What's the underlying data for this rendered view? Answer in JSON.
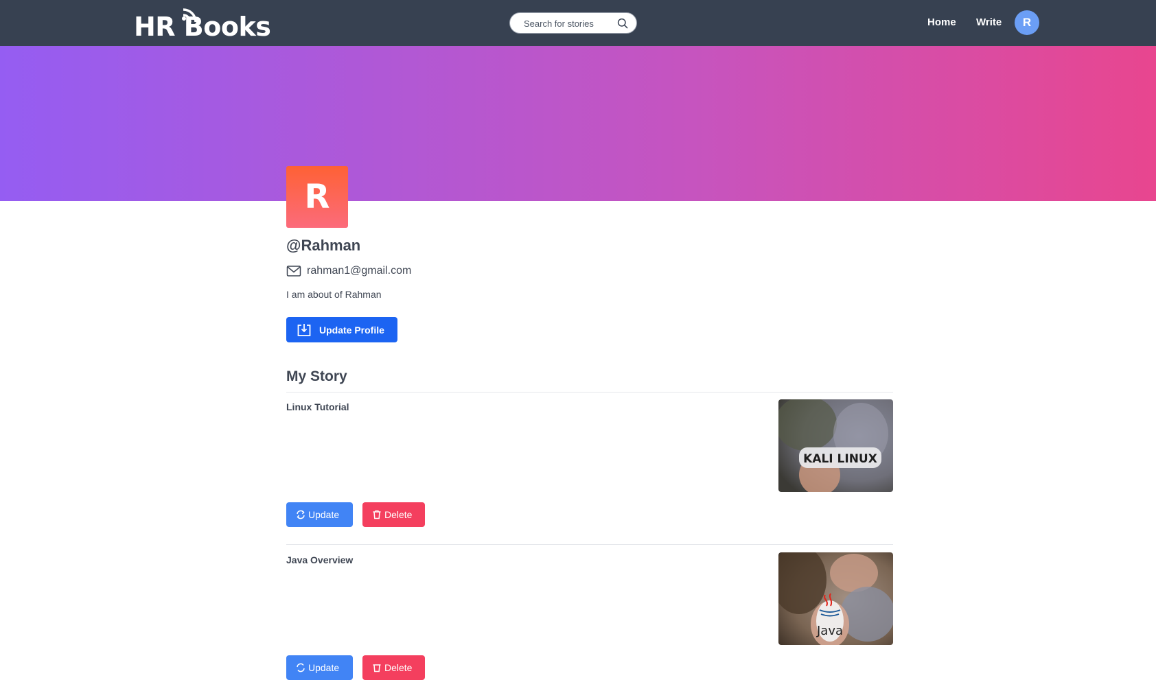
{
  "navbar": {
    "logo_text": "HR Books",
    "search_placeholder": "Search for stories",
    "home_label": "Home",
    "write_label": "Write",
    "avatar_initial": "R"
  },
  "profile": {
    "avatar_initial": "R",
    "username": "@Rahman",
    "email": "rahman1@gmail.com",
    "about": "I am about of Rahman",
    "update_button_label": "Update Profile"
  },
  "stories_section": {
    "title": "My Story",
    "update_label": "Update",
    "delete_label": "Delete",
    "items": [
      {
        "title": "Linux Tutorial",
        "thumb_text": "KALI LINUX"
      },
      {
        "title": "Java Overview",
        "thumb_text": "Java"
      }
    ]
  },
  "colors": {
    "navbar_bg": "#374151",
    "banner_start": "#955df2",
    "banner_end": "#e8468f",
    "primary_button": "#1c64f2",
    "update_button": "#4184f5",
    "delete_button": "#f43f5e",
    "avatar_gradient_top": "#fe6135"
  }
}
